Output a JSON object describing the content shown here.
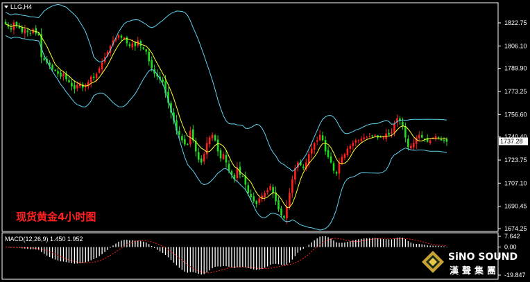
{
  "chart_data": [
    {
      "type": "candlestick",
      "symbol_label": "LLG,H4",
      "title": "现货黄金4小时图",
      "y_ticks": [
        "1822.75",
        "1806.10",
        "1789.90",
        "1773.25",
        "1756.60",
        "1740.40",
        "1723.75",
        "1707.10",
        "1690.45",
        "1674.25"
      ],
      "ylim": [
        1674.25,
        1830.0
      ],
      "current_price": "1737.28",
      "overlays": [
        "bollinger-upper",
        "bollinger-lower",
        "moving-average"
      ],
      "colors": {
        "up": "#ff2020",
        "down": "#22dd22",
        "bollinger": "#5fd3f0",
        "ma": "#ffff33",
        "grid": "#ffffff"
      },
      "close": [
        1822,
        1820,
        1818,
        1823,
        1821,
        1819,
        1816,
        1818,
        1816,
        1815,
        1818,
        1815,
        1814,
        1798,
        1796,
        1794,
        1792,
        1789,
        1788,
        1786,
        1784,
        1786,
        1782,
        1780,
        1777,
        1775,
        1778,
        1779,
        1776,
        1778,
        1780,
        1784,
        1783,
        1786,
        1790,
        1794,
        1798,
        1802,
        1806,
        1810,
        1812,
        1814,
        1812,
        1812,
        1808,
        1806,
        1808,
        1806,
        1810,
        1806,
        1804,
        1802,
        1795,
        1790,
        1786,
        1784,
        1782,
        1780,
        1772,
        1765,
        1758,
        1752,
        1745,
        1742,
        1738,
        1735,
        1735,
        1745,
        1738,
        1730,
        1724,
        1722,
        1728,
        1736,
        1740,
        1742,
        1738,
        1730,
        1725,
        1728,
        1722,
        1716,
        1713,
        1710,
        1718,
        1713,
        1712,
        1706,
        1700,
        1697,
        1694,
        1692,
        1696,
        1698,
        1700,
        1702,
        1705,
        1700,
        1694,
        1688,
        1684,
        1682,
        1690,
        1700,
        1710,
        1718,
        1722,
        1720,
        1718,
        1722,
        1728,
        1732,
        1736,
        1738,
        1742,
        1738,
        1730,
        1726,
        1722,
        1716,
        1714,
        1722,
        1726,
        1728,
        1732,
        1734,
        1736,
        1738,
        1738,
        1739,
        1740,
        1740,
        1741,
        1741,
        1742,
        1740,
        1740,
        1740,
        1743,
        1742,
        1744,
        1750,
        1754,
        1752,
        1748,
        1740,
        1733,
        1734,
        1736,
        1740,
        1742,
        1740,
        1739,
        1737,
        1738,
        1740,
        1741,
        1740,
        1738,
        1738,
        1737
      ],
      "indicator": {
        "label": "MACD(12,26,9) 1.450 1.952",
        "y_ticks": [
          "7.642",
          "0.00",
          "-19.847"
        ],
        "ylim": [
          -19.847,
          7.642
        ],
        "colors": {
          "histogram": "#ffffff",
          "signal": "#ff2020"
        }
      }
    }
  ],
  "logo": {
    "brand": "SiNO SOUND",
    "sub": "漢聲集團"
  }
}
